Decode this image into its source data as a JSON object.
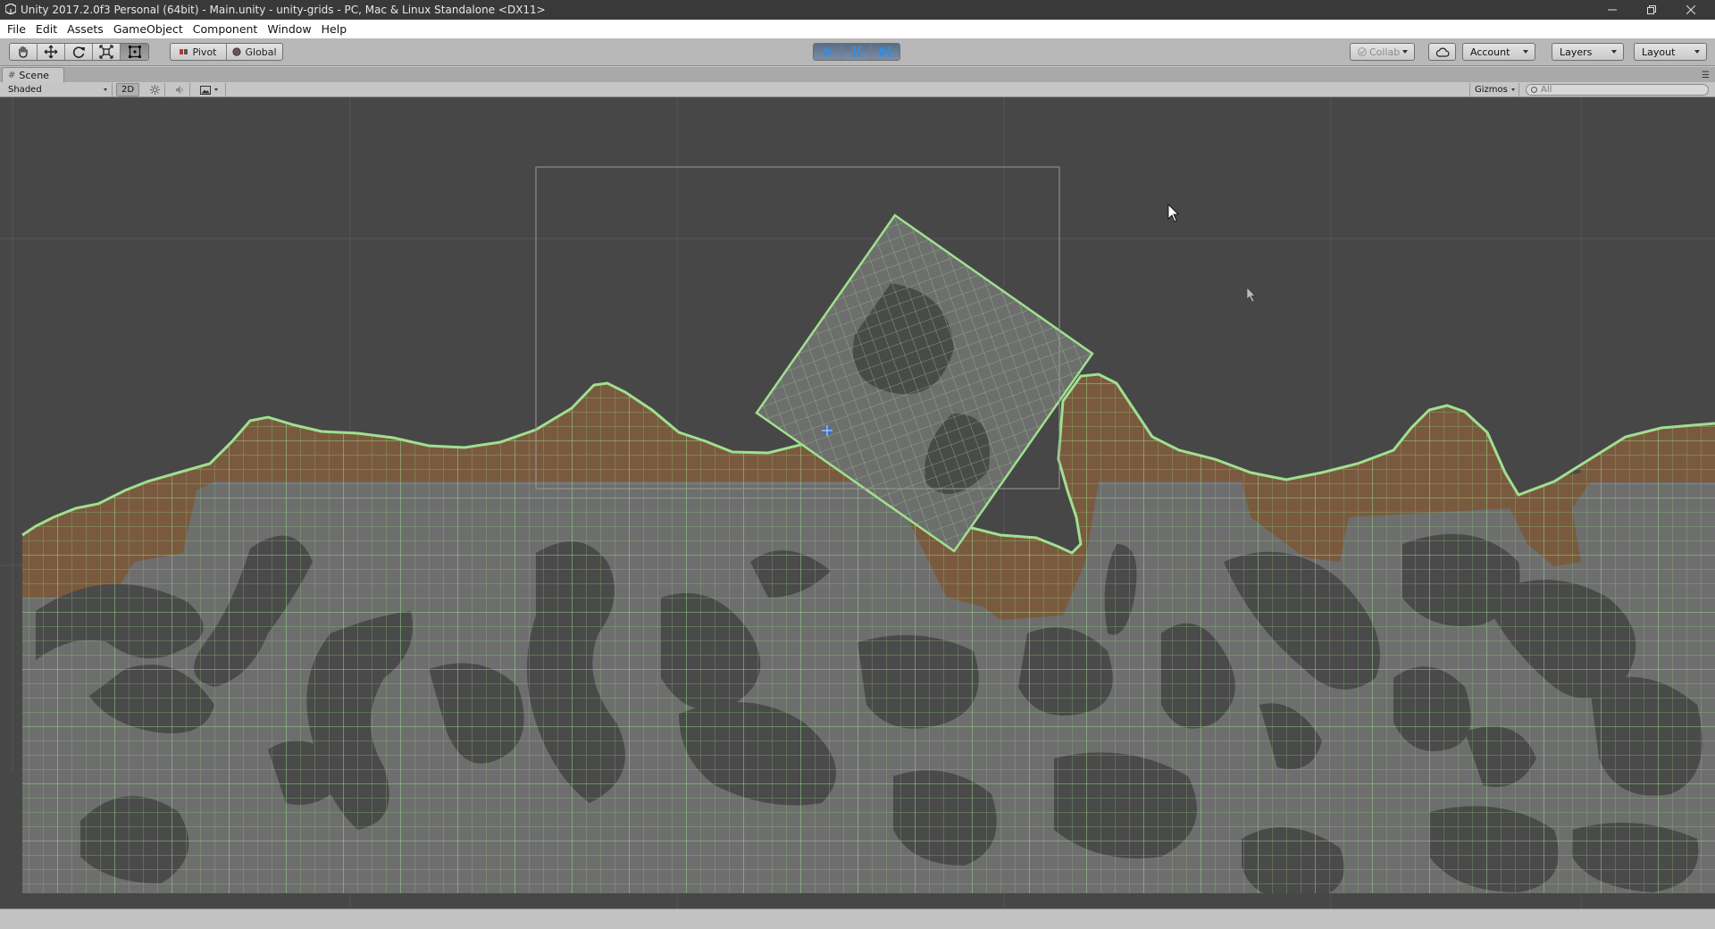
{
  "window": {
    "title": "Unity 2017.2.0f3 Personal (64bit) - Main.unity - unity-grids - PC, Mac & Linux Standalone <DX11>"
  },
  "menu": {
    "items": [
      "File",
      "Edit",
      "Assets",
      "GameObject",
      "Component",
      "Window",
      "Help"
    ]
  },
  "toolbar": {
    "transform_tools": [
      "hand-icon",
      "move-icon",
      "rotate-icon",
      "scale-icon",
      "rect-tool-icon"
    ],
    "active_tool": "rect-tool-icon",
    "pivot_label": "Pivot",
    "global_label": "Global",
    "play_state": "playing",
    "collab_label": "Collab",
    "account_label": "Account",
    "layers_label": "Layers",
    "layout_label": "Layout"
  },
  "scene": {
    "tab_label": "Scene",
    "shading_mode": "Shaded",
    "mode_2d_label": "2D",
    "gizmos_label": "Gizmos",
    "search_placeholder": "All"
  },
  "colors": {
    "background": "#474747",
    "terrain": "#6e6e6e",
    "dirt": "#7a5a3f",
    "grid_line": "#8fd07f",
    "play_blue": "#3b8cd8"
  }
}
